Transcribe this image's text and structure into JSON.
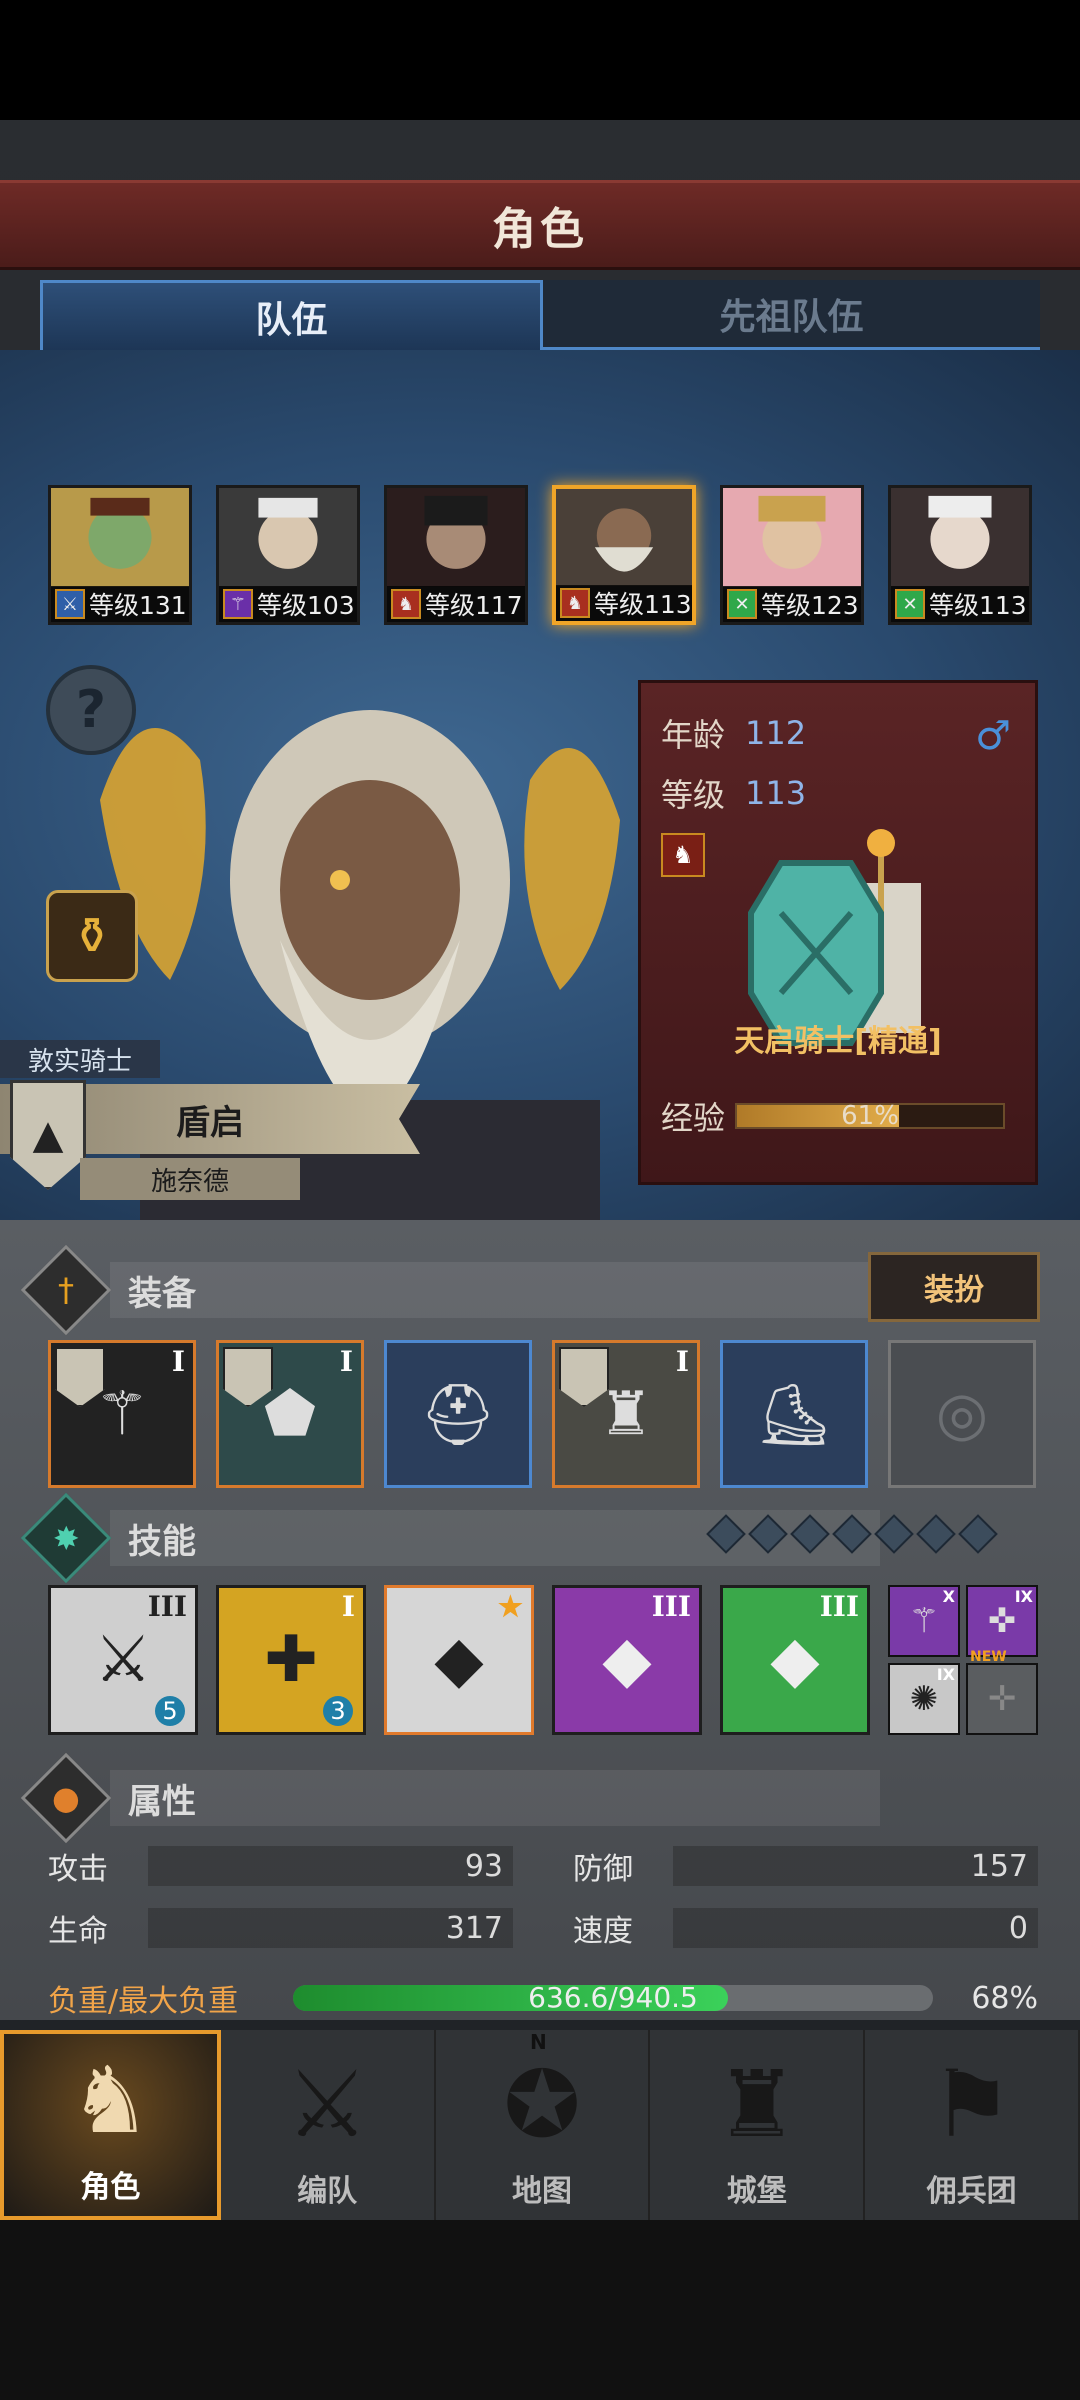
{
  "header": {
    "title": "角色"
  },
  "tabs": [
    {
      "label": "队伍",
      "active": true
    },
    {
      "label": "先祖队伍",
      "active": false
    }
  ],
  "roster": [
    {
      "level": "等级131",
      "class_icon": "sword-icon",
      "badge_color": "#2f5fa8"
    },
    {
      "level": "等级103",
      "class_icon": "staff-icon",
      "badge_color": "#6a2fa8"
    },
    {
      "level": "等级117",
      "class_icon": "horse-icon",
      "badge_color": "#a82f1f"
    },
    {
      "level": "等级113",
      "class_icon": "horse-icon",
      "badge_color": "#a82f1f",
      "selected": true
    },
    {
      "level": "等级123",
      "class_icon": "bow-icon",
      "badge_color": "#2fa84a"
    },
    {
      "level": "等级113",
      "class_icon": "bow-icon",
      "badge_color": "#2fa84a"
    }
  ],
  "hero": {
    "title": "敦实骑士",
    "name": "盾启",
    "subtitle": "施奈德",
    "age_label": "年龄",
    "age": "112",
    "level_label": "等级",
    "level": "113",
    "class_name": "天启骑士[精通]",
    "exp_label": "经验",
    "exp_text": "61%",
    "exp_fraction": 0.61
  },
  "equipment": {
    "label": "装备",
    "outfit_button": "装扮",
    "slots": [
      {
        "icon": "staff-weapon-icon",
        "tier": "I",
        "rarity": "orange"
      },
      {
        "icon": "shield-icon",
        "tier": "I",
        "rarity": "orange"
      },
      {
        "icon": "helmet-icon",
        "tier": "",
        "rarity": "blue"
      },
      {
        "icon": "armor-icon",
        "tier": "I",
        "rarity": "orange"
      },
      {
        "icon": "boots-icon",
        "tier": "",
        "rarity": "blue"
      },
      {
        "icon": "ring-icon",
        "tier": "",
        "rarity": "empty"
      }
    ]
  },
  "skills": {
    "label": "技能",
    "slots": [
      {
        "icon": "spear-skill-icon",
        "tier": "III",
        "count": "5",
        "bg": "#cfcfcf"
      },
      {
        "icon": "heal-shield-icon",
        "tier": "I",
        "count": "3",
        "bg": "#d4a422"
      },
      {
        "icon": "crystal-wing-icon",
        "tier": "★",
        "count": "",
        "bg": "#d6d6d6"
      },
      {
        "icon": "crystal-purple-icon",
        "tier": "III",
        "count": "",
        "bg": "#8a3aa8"
      },
      {
        "icon": "crystal-green-icon",
        "tier": "III",
        "count": "",
        "bg": "#3aa84a"
      }
    ],
    "mini": [
      {
        "icon": "staff-mini-icon",
        "tier": "X",
        "bg": "#7a3aa8"
      },
      {
        "icon": "target-mini-icon",
        "tier": "IX",
        "bg": "#7a3aa8"
      },
      {
        "icon": "burst-mini-icon",
        "tier": "IX",
        "bg": "#c8c8c8"
      },
      {
        "icon": "cross-mini-icon",
        "tier": "",
        "bg": "#5a5d60",
        "new": "NEW"
      }
    ]
  },
  "attributes": {
    "label": "属性",
    "rows": [
      [
        {
          "k": "攻击",
          "v": "93"
        },
        {
          "k": "防御",
          "v": "157"
        }
      ],
      [
        {
          "k": "生命",
          "v": "317"
        },
        {
          "k": "速度",
          "v": "0"
        }
      ]
    ],
    "load_label": "负重/最大负重",
    "load_text": "636.6/940.5",
    "load_pct": "68%",
    "load_fraction": 0.68
  },
  "nav": [
    {
      "label": "角色",
      "icon": "knight-icon",
      "active": true
    },
    {
      "label": "编队",
      "icon": "formation-icon"
    },
    {
      "label": "地图",
      "icon": "compass-map-icon"
    },
    {
      "label": "城堡",
      "icon": "castle-icon"
    },
    {
      "label": "佣兵团",
      "icon": "mercenary-icon"
    }
  ],
  "colors": {
    "accent": "#f0a528",
    "title_bar": "#6e2a26",
    "tab_active": "#2e4f78",
    "exp": "#e1ac4a",
    "load": "#3bd15a"
  }
}
